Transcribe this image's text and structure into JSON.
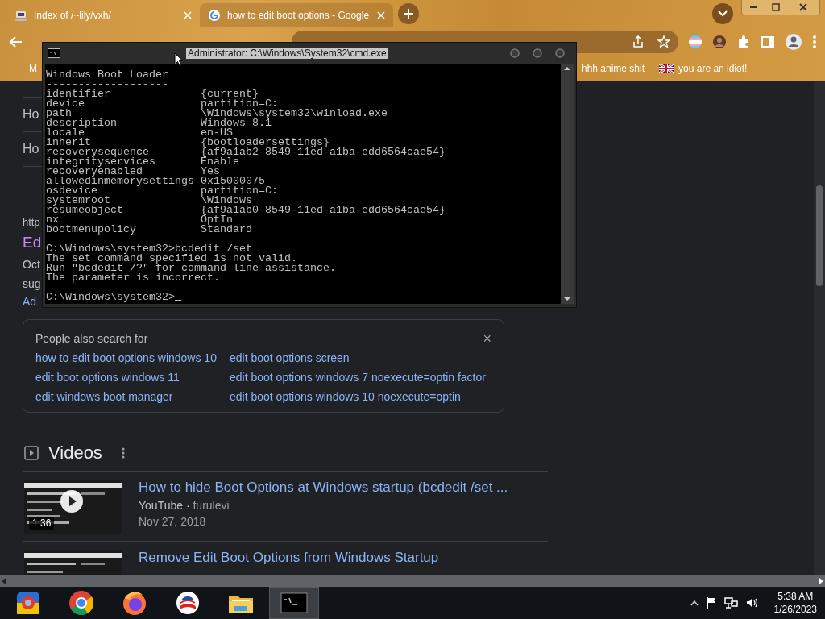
{
  "browser": {
    "tabs": [
      {
        "title": "Index of /~lily/vxh/",
        "selected": false
      },
      {
        "title": "how to edit boot options - Google",
        "selected": true
      }
    ],
    "bookmarks": [
      {
        "label": "M",
        "kind": "plain"
      },
      {
        "label": "hhh anime shit",
        "kind": "plain"
      },
      {
        "label": "you are an idiot!",
        "kind": "flag"
      }
    ]
  },
  "results": {
    "fragments": [
      {
        "text": "Ho",
        "kind": "question"
      },
      {
        "text": "Ho",
        "kind": "question"
      },
      {
        "text": "http",
        "kind": "url"
      },
      {
        "text": "Ed",
        "kind": "title"
      },
      {
        "text": "Oct",
        "kind": "snippet"
      },
      {
        "text": "sug",
        "kind": "snippet"
      },
      {
        "text": "Ad",
        "kind": "link"
      }
    ],
    "people_also_search": {
      "title": "People also search for",
      "close": "×",
      "links": [
        "how to edit boot options windows 10",
        "edit boot options screen",
        "edit boot options windows 11",
        "edit boot options windows 7 noexecute=optin factor",
        "edit windows boot manager",
        "edit boot options windows 10 noexecute=optin"
      ]
    },
    "videos": {
      "heading": "Videos",
      "items": [
        {
          "title": "How to hide Boot Options at Windows startup (bcdedit /set ...",
          "source": "YouTube",
          "separator": "·",
          "channel": "furulevi",
          "date": "Nov 27, 2018",
          "duration": "1:36"
        },
        {
          "title": "Remove Edit Boot Options from Windows Startup"
        }
      ]
    }
  },
  "cmd": {
    "title": "Administrator: C:\\Windows\\System32\\cmd.exe",
    "title_highlighted": true,
    "blocks": [
      [
        "Windows Boot Loader",
        "-------------------",
        "identifier              {current}",
        "device                  partition=C:",
        "path                    \\Windows\\system32\\winload.exe",
        "description             Windows 8.1",
        "locale                  en-US",
        "inherit                 {bootloadersettings}",
        "recoverysequence        {af9a1ab2-8549-11ed-a1ba-edd6564cae54}",
        "integrityservices       Enable",
        "recoveryenabled         Yes",
        "allowedinmemorysettings 0x15000075",
        "osdevice                partition=C:",
        "systemroot              \\Windows",
        "resumeobject            {af9a1ab0-8549-11ed-a1ba-edd6564cae54}",
        "nx                      OptIn",
        "bootmenupolicy          Standard"
      ],
      [
        "C:\\Windows\\system32>bcdedit /set",
        "The set command specified is not valid.",
        "Run \"bcdedit /?\" for command line assistance.",
        "The parameter is incorrect."
      ],
      [
        "C:\\Windows\\system32>"
      ]
    ]
  },
  "taskbar": {
    "apps": [
      {
        "kind": "colorful",
        "active": false
      },
      {
        "kind": "chrome",
        "active": false
      },
      {
        "kind": "firefox",
        "active": false
      },
      {
        "kind": "emblem",
        "active": false
      },
      {
        "kind": "folder",
        "active": false
      },
      {
        "kind": "console",
        "active": true
      }
    ],
    "time": "5:38 AM",
    "date": "1/26/2023"
  }
}
